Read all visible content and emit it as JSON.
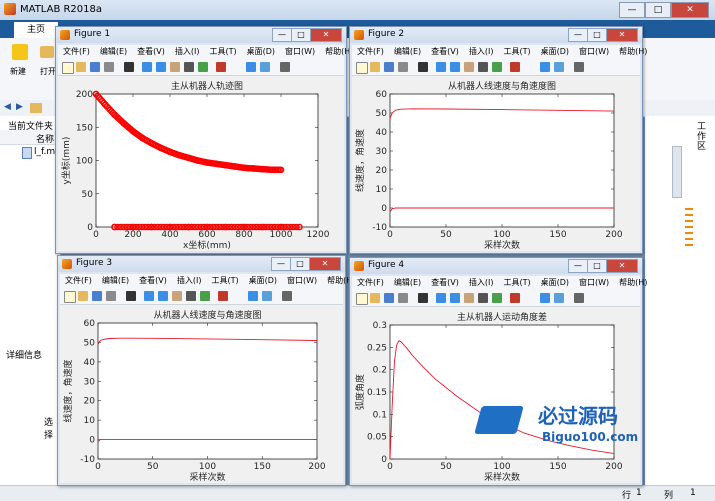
{
  "app": {
    "title": "MATLAB R2018a"
  },
  "tabs": {
    "home": "主页"
  },
  "ribbon": {
    "new_label": "新建",
    "open_label": "打开"
  },
  "file_panel": {
    "title": "当前文件夹",
    "col_name": "名称",
    "file": "l_f.m"
  },
  "detail_panel": {
    "title": "详细信息",
    "hint": "选择"
  },
  "side": {
    "workspace_label": "工作区"
  },
  "status": {
    "row_label": "行",
    "row_value": "1",
    "col_label": "列",
    "col_value": "1"
  },
  "watermark": {
    "main": "必过源码",
    "sub": "Biguo100.com"
  },
  "menu": [
    "文件(F)",
    "编辑(E)",
    "查看(V)",
    "插入(I)",
    "工具(T)",
    "桌面(D)",
    "窗口(W)",
    "帮助(H)"
  ],
  "figures": {
    "f1": {
      "title": "Figure 1"
    },
    "f2": {
      "title": "Figure 2"
    },
    "f3": {
      "title": "Figure 3"
    },
    "f4": {
      "title": "Figure 4"
    }
  },
  "chart_data": [
    {
      "type": "scatter",
      "title": "主从机器人轨迹图",
      "xlabel": "x坐标(mm)",
      "ylabel": "y坐标(mm)",
      "xlim": [
        0,
        1200
      ],
      "ylim": [
        0,
        200
      ],
      "xticks": [
        0,
        200,
        400,
        600,
        800,
        1000,
        1200
      ],
      "yticks": [
        0,
        50,
        100,
        150,
        200
      ],
      "color": "#ff0000",
      "series": [
        {
          "x": [
            0,
            50,
            100,
            150,
            200,
            250,
            300,
            350,
            400,
            450,
            500,
            550,
            600,
            650,
            700,
            750,
            800,
            850,
            900,
            950,
            1000
          ],
          "values": [
            200,
            184,
            169,
            156,
            144,
            134,
            126,
            119,
            113,
            108,
            104,
            100,
            97,
            95,
            93,
            91,
            89,
            88,
            87,
            86,
            86
          ]
        },
        {
          "x": [
            100,
            200,
            300,
            400,
            500,
            600,
            700,
            800,
            900,
            1000,
            1100
          ],
          "values": [
            0,
            0,
            0,
            0,
            0,
            0,
            0,
            0,
            0,
            0,
            0
          ]
        }
      ]
    },
    {
      "type": "line",
      "title": "从机器人线速度与角速度图",
      "xlabel": "采样次数",
      "ylabel": "线速度，角速度",
      "xlim": [
        0,
        200
      ],
      "ylim": [
        -10,
        60
      ],
      "xticks": [
        0,
        50,
        100,
        150,
        200
      ],
      "yticks": [
        -10,
        0,
        10,
        20,
        30,
        40,
        50,
        60
      ],
      "color": "#e8192c",
      "series": [
        {
          "x": [
            0,
            2,
            5,
            10,
            20,
            50,
            100,
            150,
            200
          ],
          "values": [
            47,
            50,
            51.5,
            52,
            52.2,
            52.1,
            51.8,
            51.4,
            51
          ]
        },
        {
          "x": [
            0,
            2,
            5,
            200
          ],
          "values": [
            -2,
            -0.5,
            0,
            0
          ]
        }
      ]
    },
    {
      "type": "line",
      "title": "从机器人线速度与角速度图",
      "xlabel": "采样次数",
      "ylabel": "线速度，角速度",
      "xlim": [
        0,
        200
      ],
      "ylim": [
        -10,
        60
      ],
      "xticks": [
        0,
        50,
        100,
        150,
        200
      ],
      "yticks": [
        -10,
        0,
        10,
        20,
        30,
        40,
        50,
        60
      ],
      "color": "#e8192c",
      "series": [
        {
          "x": [
            0,
            2,
            5,
            10,
            20,
            50,
            100,
            150,
            200
          ],
          "values": [
            49,
            51,
            51.5,
            52,
            52.2,
            52.1,
            51.8,
            51.4,
            51
          ]
        },
        {
          "x": [
            0,
            2,
            5,
            200
          ],
          "values": [
            -1,
            0,
            0,
            0
          ]
        }
      ]
    },
    {
      "type": "line",
      "title": "主从机器人运动角度差",
      "xlabel": "采样次数",
      "ylabel": "弧度角度",
      "xlim": [
        0,
        200
      ],
      "ylim": [
        0,
        0.3
      ],
      "xticks": [
        0,
        50,
        100,
        150,
        200
      ],
      "yticks": [
        0,
        0.05,
        0.1,
        0.15,
        0.2,
        0.25,
        0.3
      ],
      "color": "#e8192c",
      "series": [
        {
          "x": [
            0,
            2,
            4,
            6,
            8,
            10,
            15,
            20,
            30,
            40,
            60,
            80,
            100,
            120,
            140,
            160,
            180,
            200
          ],
          "values": [
            0,
            0.12,
            0.22,
            0.255,
            0.265,
            0.262,
            0.248,
            0.232,
            0.205,
            0.18,
            0.14,
            0.105,
            0.08,
            0.058,
            0.042,
            0.03,
            0.02,
            0.012
          ]
        }
      ]
    }
  ]
}
